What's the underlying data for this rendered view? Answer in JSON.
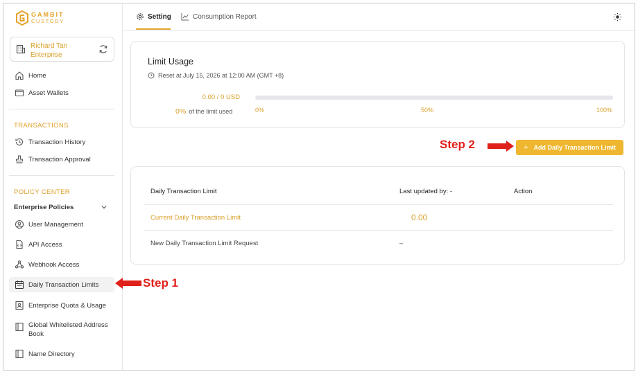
{
  "brand": {
    "name_top": "GAMBIT",
    "name_bottom": "CUSTODY",
    "color": "#E2A32A"
  },
  "account": {
    "name": "Richard Tan",
    "type": "Enterprise"
  },
  "nav": {
    "home": "Home",
    "asset_wallets": "Asset Wallets",
    "transactions_header": "TRANSACTIONS",
    "transaction_history": "Transaction History",
    "transaction_approval": "Transaction Approval",
    "policy_center_header": "POLICY CENTER",
    "enterprise_policies": "Enterprise Policies",
    "user_management": "User Management",
    "api_access": "API Access",
    "webhook_access": "Webhook Access",
    "daily_transaction_limits": "Daily Transaction Limits",
    "enterprise_quota": "Enterprise Quota & Usage",
    "global_whitelisted_1": "Global Whitelisted Address",
    "global_whitelisted_2": "Book",
    "name_directory": "Name Directory"
  },
  "tabs": {
    "setting": "Setting",
    "consumption_report": "Consumption Report"
  },
  "limit_usage": {
    "title": "Limit Usage",
    "reset_text": "Reset at July 15, 2026 at 12:00 AM (GMT +8)",
    "used_amount": "0.00 / 0 USD",
    "percent": "0%",
    "percent_suffix": "of the limit used",
    "progress": 0,
    "tick_0": "0%",
    "tick_50": "50%",
    "tick_100": "100%"
  },
  "add_button": {
    "label": "Add Daily Transaction Limit"
  },
  "table": {
    "headers": {
      "limit": "Daily Transaction Limit",
      "updated": "Last updated by: -",
      "action": "Action"
    },
    "rows": [
      {
        "label": "Current Daily Transaction Limit",
        "value": "0.00"
      },
      {
        "label": "New Daily Transaction Limit Request",
        "value": "–"
      }
    ]
  },
  "annotations": {
    "step1": "Step 1",
    "step2": "Step 2",
    "arrow_color": "#E0201A"
  }
}
